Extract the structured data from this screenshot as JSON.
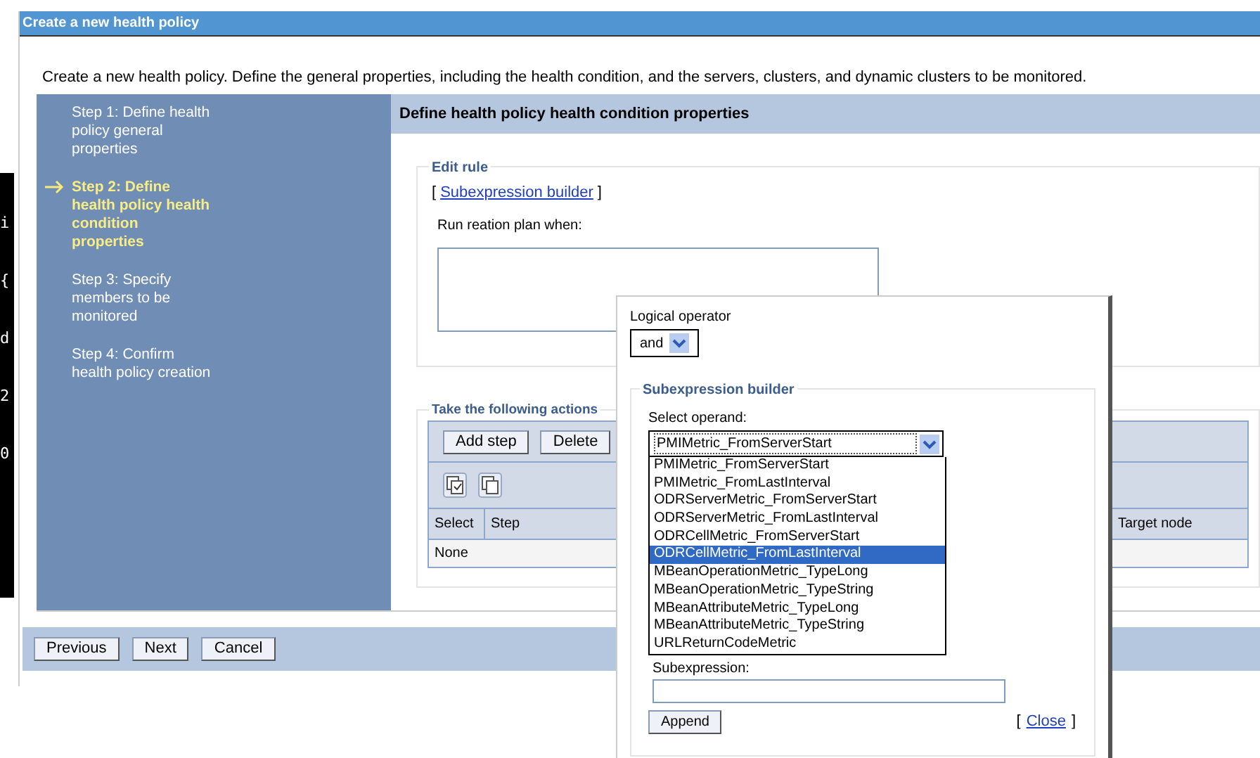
{
  "background_glyphs": [
    "i",
    "{",
    "d",
    "2",
    "0"
  ],
  "window": {
    "title": "Create a new health policy",
    "description": "Create a new health policy. Define the general properties, including the health condition, and the servers, clusters, and dynamic clusters to be monitored."
  },
  "steps": [
    {
      "label": "Step 1: Define health policy general properties",
      "selected": false
    },
    {
      "label": "Step 2: Define health policy health condition properties",
      "selected": true
    },
    {
      "label": "Step 3: Specify members to be monitored",
      "selected": false
    },
    {
      "label": "Step 4: Confirm health policy creation",
      "selected": false
    }
  ],
  "content": {
    "heading": "Define health policy health condition properties",
    "edit_rule": {
      "legend": "Edit rule",
      "bracket_open": "[",
      "link": "Subexpression builder",
      "bracket_close": "]",
      "label": "Run reation plan when:"
    },
    "actions": {
      "legend": "Take the following actions",
      "buttons": [
        "Add step",
        "Delete"
      ],
      "columns": [
        "Select",
        "Step",
        "Target node"
      ],
      "empty_text": "None"
    }
  },
  "footer": {
    "buttons": [
      "Previous",
      "Next",
      "Cancel"
    ]
  },
  "popup": {
    "operator_label": "Logical operator",
    "operator_value": "and",
    "legend": "Subexpression builder",
    "operand_label": "Select operand:",
    "operand_value": "PMIMetric_FromServerStart",
    "options": [
      {
        "label": "PMIMetric_FromServerStart",
        "selected": false
      },
      {
        "label": "PMIMetric_FromLastInterval",
        "selected": false
      },
      {
        "label": "ODRServerMetric_FromServerStart",
        "selected": false
      },
      {
        "label": "ODRServerMetric_FromLastInterval",
        "selected": false
      },
      {
        "label": "ODRCellMetric_FromServerStart",
        "selected": false
      },
      {
        "label": "ODRCellMetric_FromLastInterval",
        "selected": true
      },
      {
        "label": "MBeanOperationMetric_TypeLong",
        "selected": false
      },
      {
        "label": "MBeanOperationMetric_TypeString",
        "selected": false
      },
      {
        "label": "MBeanAttributeMetric_TypeLong",
        "selected": false
      },
      {
        "label": "MBeanAttributeMetric_TypeString",
        "selected": false
      },
      {
        "label": "URLReturnCodeMetric",
        "selected": false
      }
    ],
    "subexpression_label": "Subexpression:",
    "append_button": "Append",
    "bracket_open": "[",
    "close_link": "Close",
    "bracket_close": "]"
  }
}
